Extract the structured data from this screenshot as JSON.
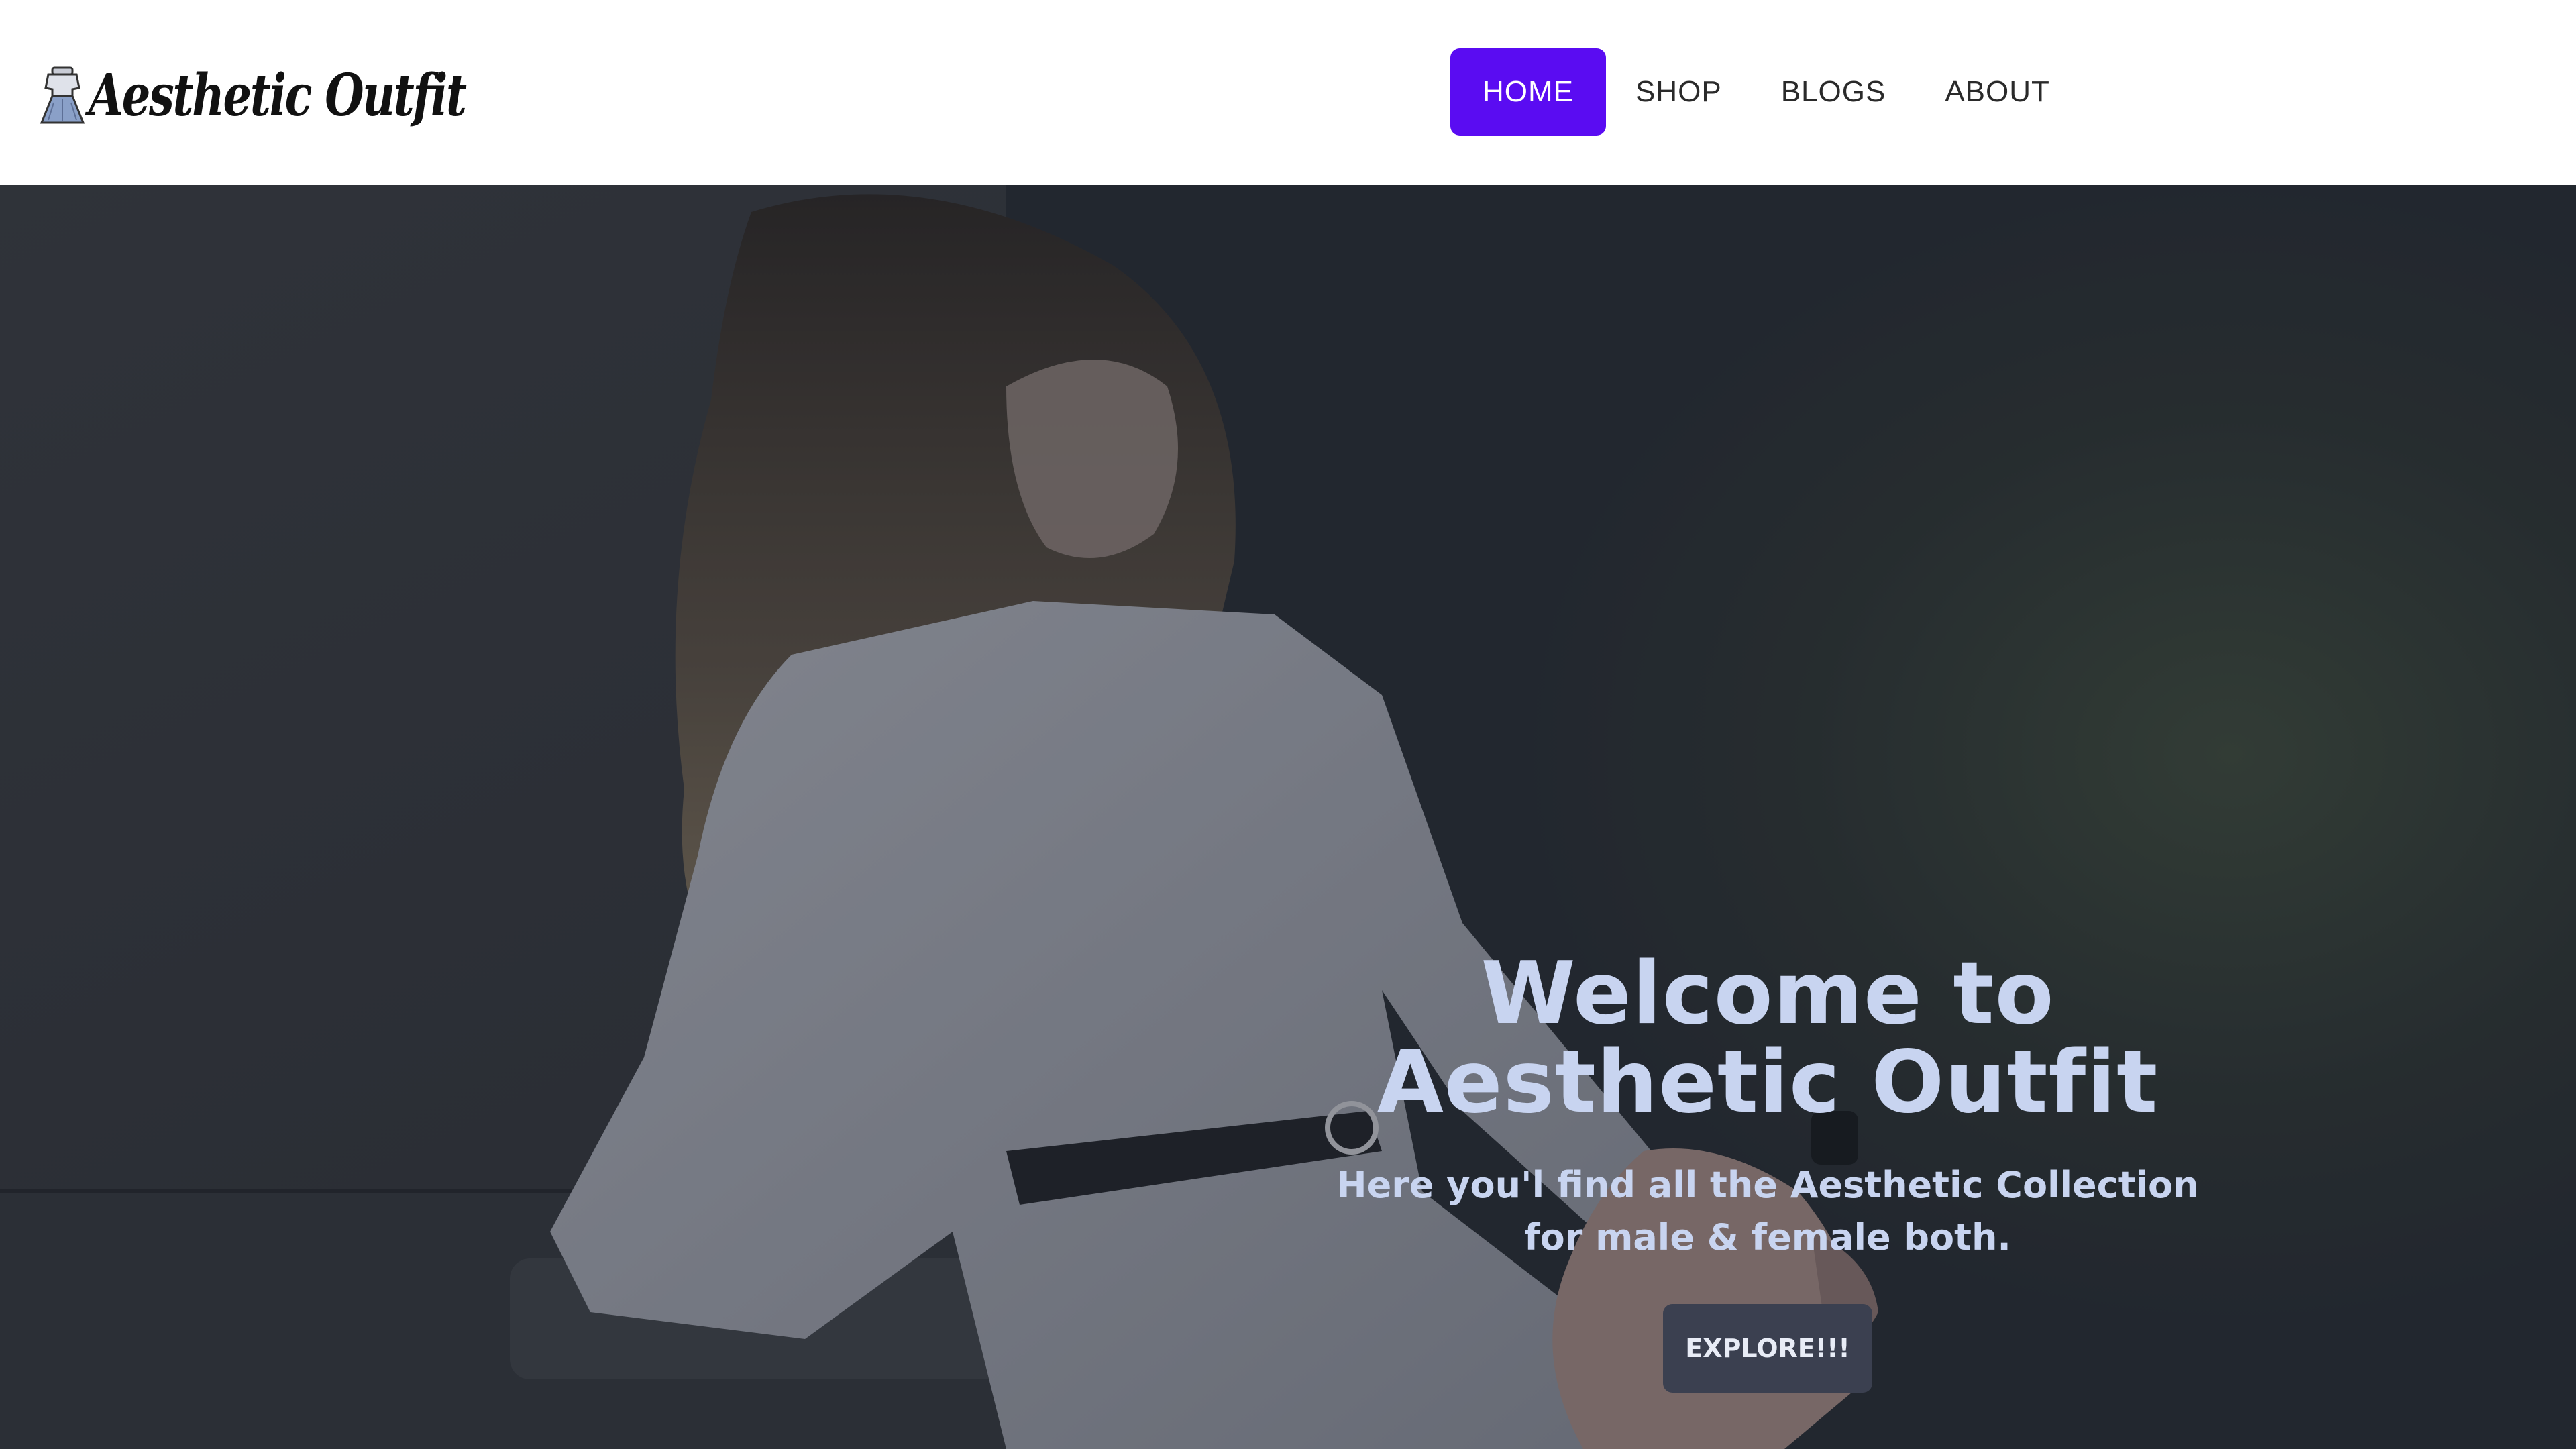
{
  "brand": {
    "name": "Aesthetic Outfit",
    "logo_icon": "dress-icon"
  },
  "nav": {
    "items": [
      {
        "label": "HOME",
        "active": true
      },
      {
        "label": "SHOP",
        "active": false
      },
      {
        "label": "BLOGS",
        "active": false
      },
      {
        "label": "ABOUT",
        "active": false
      }
    ]
  },
  "hero": {
    "title_line1": "Welcome to",
    "title_line2": "Aesthetic Outfit",
    "subtitle_line1": "Here you'l find all the Aesthetic Collection",
    "subtitle_line2": "for male & female both.",
    "button_label": "EXPLORE!!!"
  },
  "colors": {
    "accent": "#5a0cf2",
    "hero_text": "#c8d4f0",
    "button_bg": "#3b4050"
  }
}
